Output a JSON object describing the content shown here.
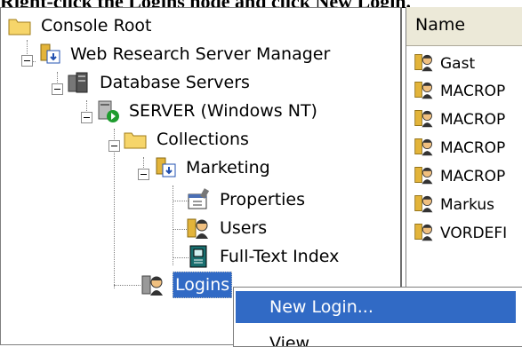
{
  "caption": "Right-click the Logins node and click New Login.",
  "tree": {
    "nodes": [
      {
        "label": "Console Root"
      },
      {
        "label": "Web Research Server Manager"
      },
      {
        "label": "Database Servers"
      },
      {
        "label": "SERVER (Windows NT)"
      },
      {
        "label": "Collections"
      },
      {
        "label": "Marketing"
      },
      {
        "label": "Properties"
      },
      {
        "label": "Users"
      },
      {
        "label": "Full-Text Index"
      },
      {
        "label": "Logins"
      }
    ]
  },
  "list": {
    "column": "Name",
    "items": [
      "Gast",
      "MACROP",
      "MACROP",
      "MACROP",
      "MACROP",
      "Markus",
      "VORDEFI"
    ]
  },
  "context_menu": {
    "items": [
      "New Login...",
      "View"
    ]
  }
}
